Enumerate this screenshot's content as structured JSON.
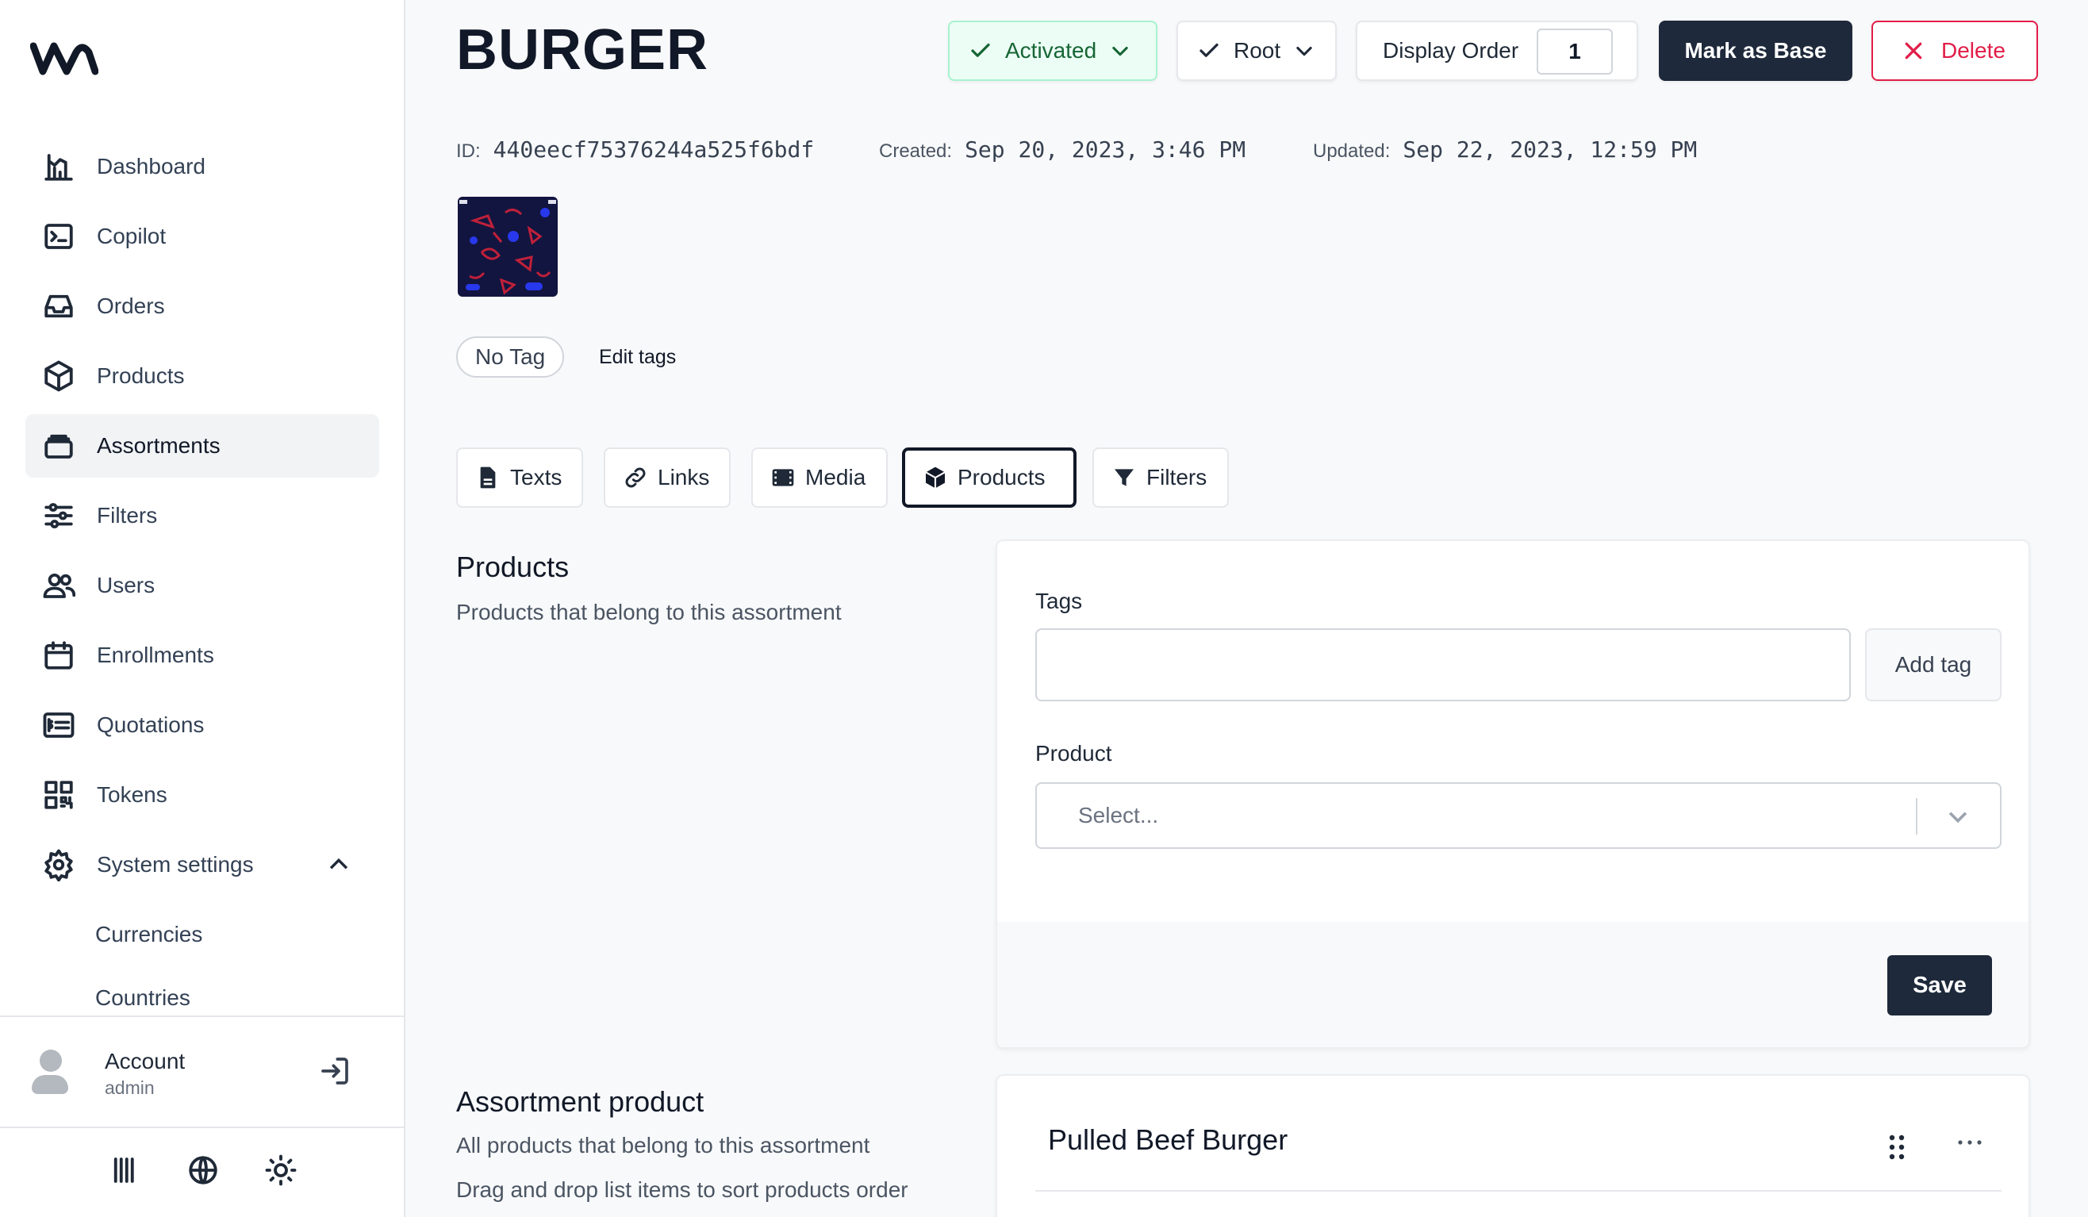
{
  "sidebar": {
    "items": [
      {
        "label": "Dashboard",
        "icon": "dashboard-icon"
      },
      {
        "label": "Copilot",
        "icon": "terminal-icon"
      },
      {
        "label": "Orders",
        "icon": "inbox-icon"
      },
      {
        "label": "Products",
        "icon": "cube-icon"
      },
      {
        "label": "Assortments",
        "icon": "folder-stack-icon",
        "active": true
      },
      {
        "label": "Filters",
        "icon": "sliders-icon"
      },
      {
        "label": "Users",
        "icon": "users-icon"
      },
      {
        "label": "Enrollments",
        "icon": "calendar-icon"
      },
      {
        "label": "Quotations",
        "icon": "price-list-icon"
      },
      {
        "label": "Tokens",
        "icon": "qr-code-icon"
      },
      {
        "label": "System settings",
        "icon": "gear-icon",
        "expanded": true
      }
    ],
    "sub_items": [
      {
        "label": "Currencies"
      },
      {
        "label": "Countries"
      }
    ],
    "account": {
      "name": "Account",
      "role": "admin"
    }
  },
  "header": {
    "title": "BURGER",
    "status_label": "Activated",
    "root_label": "Root",
    "display_order_label": "Display Order",
    "display_order_value": "1",
    "mark_base_label": "Mark as Base",
    "delete_label": "Delete"
  },
  "meta": {
    "id_label": "ID:",
    "id_value": "440eecf75376244a525f6bdf",
    "created_label": "Created:",
    "created_value": "Sep 20, 2023, 3:46 PM",
    "updated_label": "Updated:",
    "updated_value": "Sep 22, 2023, 12:59 PM"
  },
  "tags": {
    "pill": "No Tag",
    "edit_label": "Edit tags"
  },
  "tabs": [
    {
      "label": "Texts",
      "icon": "document-icon"
    },
    {
      "label": "Links",
      "icon": "link-icon"
    },
    {
      "label": "Media",
      "icon": "film-icon"
    },
    {
      "label": "Products",
      "icon": "cube-icon",
      "active": true
    },
    {
      "label": "Filters",
      "icon": "funnel-icon"
    }
  ],
  "products_section": {
    "title": "Products",
    "description": "Products that belong to this assortment",
    "tags_label": "Tags",
    "tags_value": "",
    "add_tag_label": "Add tag",
    "product_label": "Product",
    "product_placeholder": "Select...",
    "save_label": "Save"
  },
  "assortment_product_section": {
    "title": "Assortment product",
    "description_1": "All products that belong to this assortment",
    "description_2": "Drag and drop list items to sort products order",
    "items": [
      {
        "name": "Pulled Beef Burger"
      }
    ]
  },
  "colors": {
    "accent_dark": "#1e293b",
    "activated_bg": "#ecfdf5",
    "activated_text": "#166534",
    "delete_red": "#e11d48"
  }
}
